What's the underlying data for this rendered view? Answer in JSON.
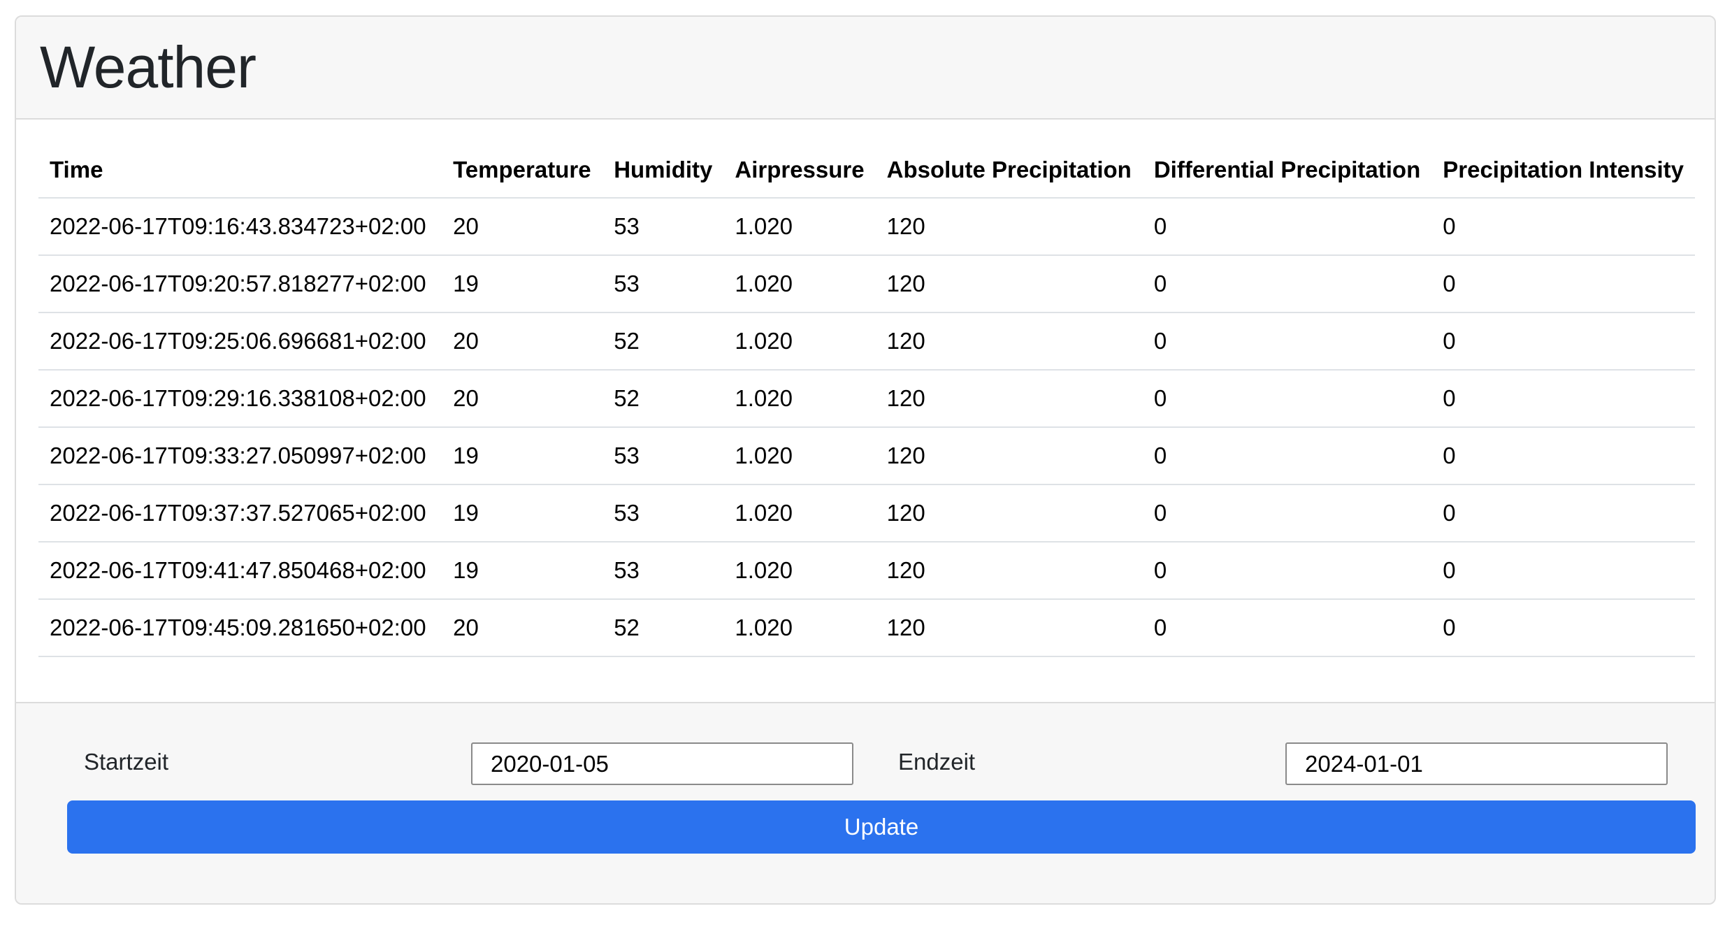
{
  "header": {
    "title": "Weather"
  },
  "table": {
    "columns": [
      "Time",
      "Temperature",
      "Humidity",
      "Airpressure",
      "Absolute Precipitation",
      "Differential Precipitation",
      "Precipitation Intensity"
    ],
    "rows": [
      [
        "2022-06-17T09:16:43.834723+02:00",
        "20",
        "53",
        "1.020",
        "120",
        "0",
        "0"
      ],
      [
        "2022-06-17T09:20:57.818277+02:00",
        "19",
        "53",
        "1.020",
        "120",
        "0",
        "0"
      ],
      [
        "2022-06-17T09:25:06.696681+02:00",
        "20",
        "52",
        "1.020",
        "120",
        "0",
        "0"
      ],
      [
        "2022-06-17T09:29:16.338108+02:00",
        "20",
        "52",
        "1.020",
        "120",
        "0",
        "0"
      ],
      [
        "2022-06-17T09:33:27.050997+02:00",
        "19",
        "53",
        "1.020",
        "120",
        "0",
        "0"
      ],
      [
        "2022-06-17T09:37:37.527065+02:00",
        "19",
        "53",
        "1.020",
        "120",
        "0",
        "0"
      ],
      [
        "2022-06-17T09:41:47.850468+02:00",
        "19",
        "53",
        "1.020",
        "120",
        "0",
        "0"
      ],
      [
        "2022-06-17T09:45:09.281650+02:00",
        "20",
        "52",
        "1.020",
        "120",
        "0",
        "0"
      ]
    ]
  },
  "footer": {
    "start_label": "Startzeit",
    "start_value": "2020-01-05",
    "end_label": "Endzeit",
    "end_value": "2024-01-01",
    "update_label": "Update"
  },
  "colors": {
    "button_primary": "#2b72ee",
    "header_background": "#f7f7f7",
    "border": "#dcdcdc"
  }
}
